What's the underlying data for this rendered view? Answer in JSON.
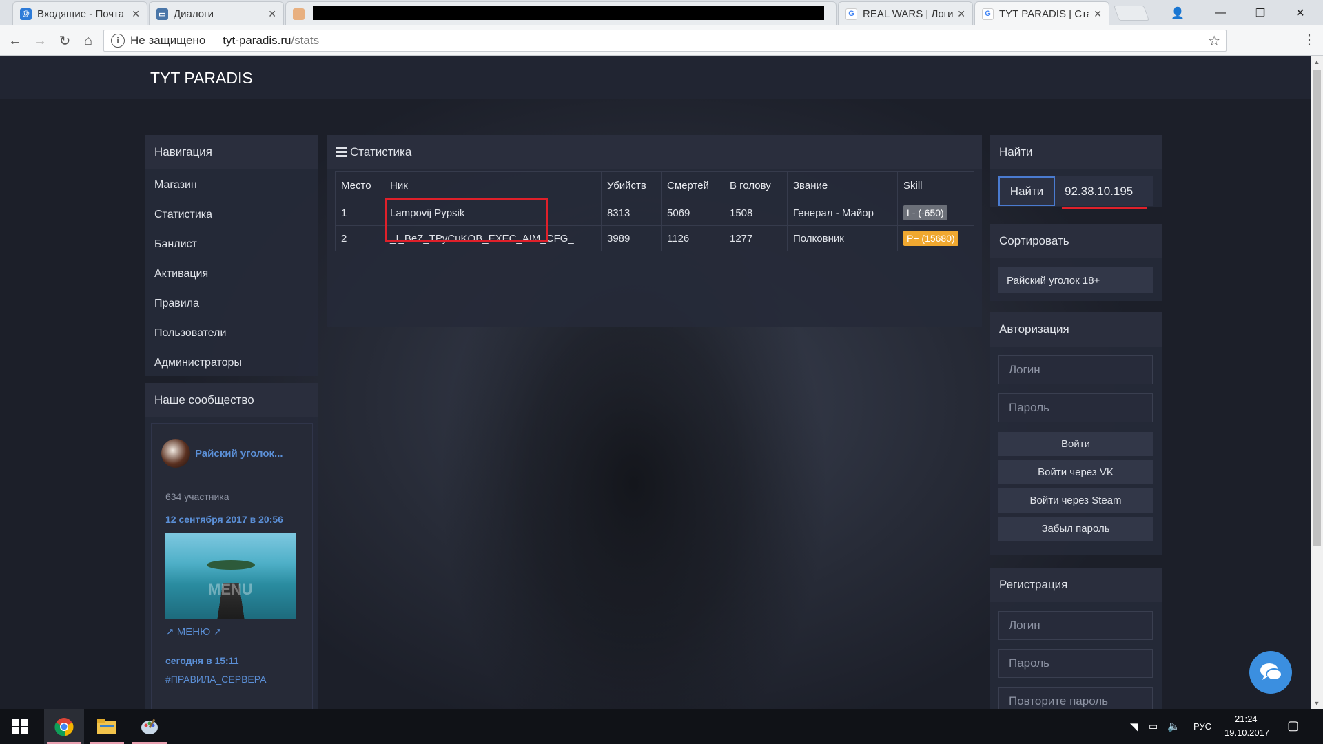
{
  "browser": {
    "tabs": [
      {
        "label": "Входящие - Почта",
        "icon": "mail-icon"
      },
      {
        "label": "Диалоги",
        "icon": "vk-icon"
      },
      {
        "label": "",
        "icon": "redacted-tab-icon"
      },
      {
        "label": "REAL WARS | Логи",
        "icon": "google-icon"
      },
      {
        "label": "TYT PARADIS | Ста",
        "icon": "google-icon"
      }
    ],
    "security_label": "Не защищено",
    "url_host": "tyt-paradis.ru",
    "url_path": "/stats"
  },
  "site": {
    "brand": "TYT PARADIS"
  },
  "sidebar": {
    "nav_title": "Навигация",
    "items": [
      {
        "label": "Магазин"
      },
      {
        "label": "Статистика"
      },
      {
        "label": "Банлист"
      },
      {
        "label": "Активация"
      },
      {
        "label": "Правила"
      },
      {
        "label": "Пользователи"
      },
      {
        "label": "Администраторы"
      }
    ],
    "community_title": "Наше сообщество",
    "vk_widget": {
      "group_name": "Райский уголок...",
      "members": "634 участника",
      "post1_date": "12 сентября 2017 в 20:56",
      "post1_image_text": "MENU",
      "post1_caption": "↗ МЕНЮ ↗",
      "post2_date": "сегодня в 15:11",
      "post2_tag": "#ПРАВИЛА_СЕРВЕРА"
    }
  },
  "stats": {
    "title": "Статистика",
    "columns": [
      "Место",
      "Ник",
      "Убийств",
      "Смертей",
      "В голову",
      "Звание",
      "Skill"
    ],
    "rows": [
      {
        "place": "1",
        "nick": "Lampovij Pypsik",
        "kills": "8313",
        "deaths": "5069",
        "headshots": "1508",
        "rank": "Генерал - Майор",
        "skill": "L- (-650)",
        "skill_color": "#6b6f78"
      },
      {
        "place": "2",
        "nick": "_I_BeZ_TPyCuKOB_EXEC_AIM_CFG_",
        "kills": "3989",
        "deaths": "1126",
        "headshots": "1277",
        "rank": "Полковник",
        "skill": "P+ (15680)",
        "skill_color": "#f0a830"
      }
    ]
  },
  "right": {
    "find_title": "Найти",
    "find_button": "Найти",
    "find_value": "92.38.10.195",
    "sort_title": "Сортировать",
    "sort_value": "Райский уголок 18+",
    "auth_title": "Авторизация",
    "login_placeholder": "Логин",
    "password_placeholder": "Пароль",
    "login_button": "Войти",
    "vk_button": "Войти через VK",
    "steam_button": "Войти через Steam",
    "forgot_button": "Забыл пароль",
    "reg_title": "Регистрация",
    "reg_login_placeholder": "Логин",
    "reg_password_placeholder": "Пароль",
    "reg_repeat_placeholder": "Повторите пароль"
  },
  "taskbar": {
    "lang": "РУС",
    "time": "21:24",
    "date": "19.10.2017"
  },
  "colors": {
    "annotation_red": "#e0202a",
    "link_blue": "#5b8fd6",
    "chat_blue": "#3b8fe0"
  }
}
